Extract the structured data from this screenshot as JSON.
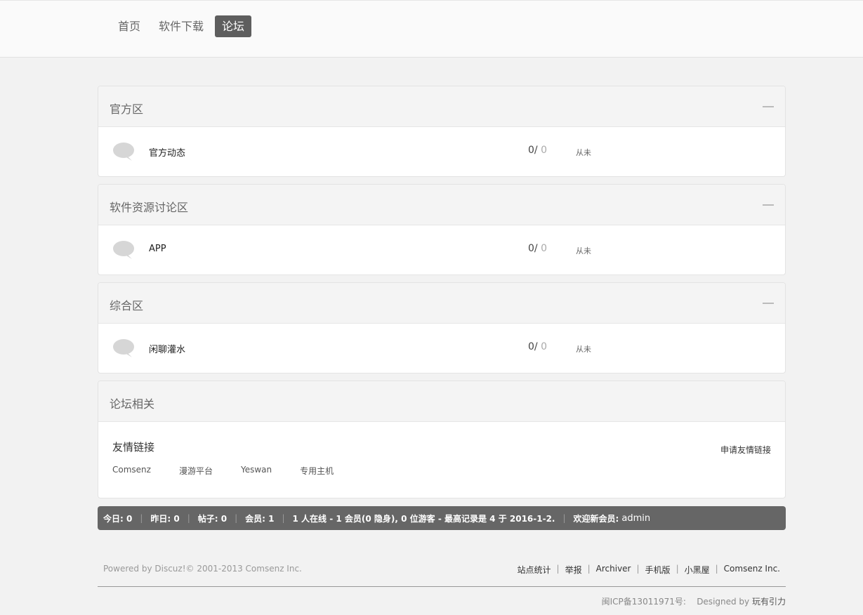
{
  "nav": {
    "items": [
      {
        "label": "首页",
        "active": false
      },
      {
        "label": "软件下载",
        "active": false
      },
      {
        "label": "论坛",
        "active": true
      }
    ]
  },
  "sections": [
    {
      "title": "官方区",
      "forums": [
        {
          "name": "官方动态",
          "threads": "0/",
          "posts": "0",
          "last": "从未"
        }
      ]
    },
    {
      "title": "软件资源讨论区",
      "forums": [
        {
          "name": "APP",
          "threads": "0/",
          "posts": "0",
          "last": "从未"
        }
      ]
    },
    {
      "title": "综合区",
      "forums": [
        {
          "name": "闲聊灌水",
          "threads": "0/",
          "posts": "0",
          "last": "从未"
        }
      ]
    }
  ],
  "related": {
    "title": "论坛相关",
    "links_title": "友情链接",
    "apply_label": "申请友情链接",
    "links": [
      "Comsenz",
      "漫游平台",
      "Yeswan",
      "专用主机"
    ]
  },
  "stats": {
    "today": "今日: 0",
    "yesterday": "昨日: 0",
    "posts": "帖子: 0",
    "members": "会员: 1",
    "online": "1 人在线 - 1 会员(0 隐身), 0 位游客 - 最高记录是 4 于 2016-1-2.",
    "welcome": "欢迎新会员:",
    "newest": "admin"
  },
  "footer": {
    "powered": "Powered by Discuz!© 2001-2013 Comsenz Inc.",
    "links": [
      "站点统计",
      "举报",
      "Archiver",
      "手机版",
      "小黑屋",
      "Comsenz Inc."
    ],
    "icp": "闽ICP备13011971号:",
    "designed_prefix": "Designed by",
    "designed_by": "玩有引力"
  },
  "colors": {
    "nav_active_bg": "#5e5e5e",
    "stats_bg": "#666666",
    "page_bg": "#f2f2f2"
  }
}
